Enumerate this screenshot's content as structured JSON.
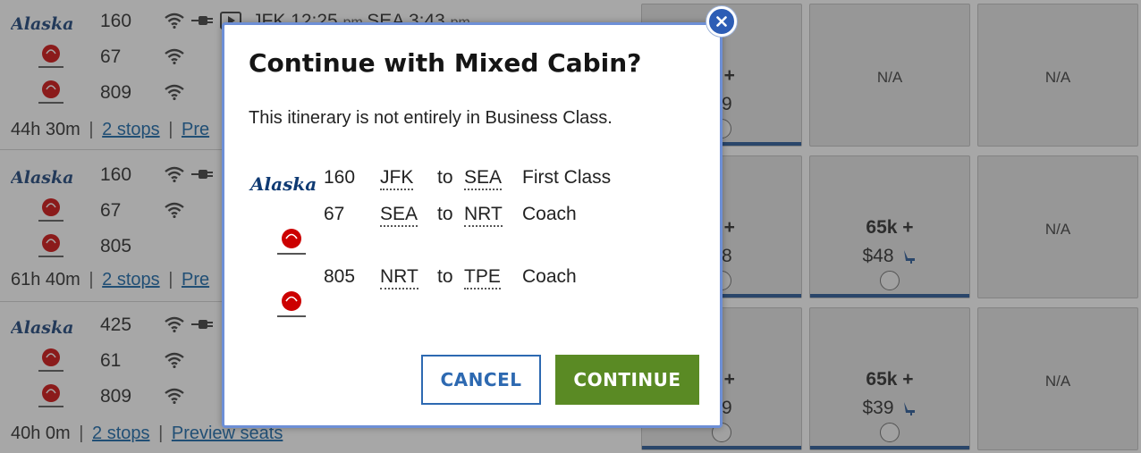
{
  "airlines": {
    "alaska": {
      "logo_text": "Alaska",
      "color": "#0f3a73"
    },
    "jal": {
      "color": "#cc0000"
    }
  },
  "background": {
    "rows": [
      {
        "segments": [
          {
            "airline": "alaska",
            "flight": "160",
            "route": "JFK 12:25 pm SEA 3:43 pm"
          },
          {
            "airline": "jal",
            "flight": "67"
          },
          {
            "airline": "jal",
            "flight": "809"
          }
        ],
        "duration": "44h 30m",
        "stops": "2 stops",
        "preview": "Pre"
      },
      {
        "segments": [
          {
            "airline": "alaska",
            "flight": "160"
          },
          {
            "airline": "jal",
            "flight": "67"
          },
          {
            "airline": "jal",
            "flight": "805"
          }
        ],
        "duration": "61h 40m",
        "stops": "2 stops",
        "preview": "Pre"
      },
      {
        "segments": [
          {
            "airline": "alaska",
            "flight": "425"
          },
          {
            "airline": "jal",
            "flight": "61"
          },
          {
            "airline": "jal",
            "flight": "809"
          }
        ],
        "duration": "40h 0m",
        "stops": "2 stops",
        "preview": "Preview seats"
      }
    ],
    "fare_grid": [
      [
        {
          "price": "k +",
          "fee": "39"
        },
        {
          "na": "N/A"
        },
        {
          "na": "N/A"
        }
      ],
      [
        {
          "price": "k +",
          "fee": "48"
        },
        {
          "price": "65k +",
          "fee": "$48"
        },
        {
          "na": "N/A"
        }
      ],
      [
        {
          "price": "k +",
          "fee": "39"
        },
        {
          "price": "65k +",
          "fee": "$39"
        },
        {
          "na": "N/A"
        }
      ]
    ]
  },
  "modal": {
    "title": "Continue with Mixed Cabin?",
    "message": "This itinerary is not entirely in Business Class.",
    "segments": [
      {
        "airline": "alaska",
        "flight": "160",
        "origin": "JFK",
        "to": "to",
        "destination": "SEA",
        "cabin": "First Class"
      },
      {
        "airline": "jal",
        "flight": "67",
        "origin": "SEA",
        "to": "to",
        "destination": "NRT",
        "cabin": "Coach"
      },
      {
        "airline": "jal",
        "flight": "805",
        "origin": "NRT",
        "to": "to",
        "destination": "TPE",
        "cabin": "Coach"
      }
    ],
    "cancel_label": "CANCEL",
    "continue_label": "CONTINUE",
    "close_label": "x",
    "colors": {
      "border": "#6d8fd6",
      "cancel": "#2d69b1",
      "continue": "#5a8a24",
      "close": "#2d5db5"
    }
  }
}
